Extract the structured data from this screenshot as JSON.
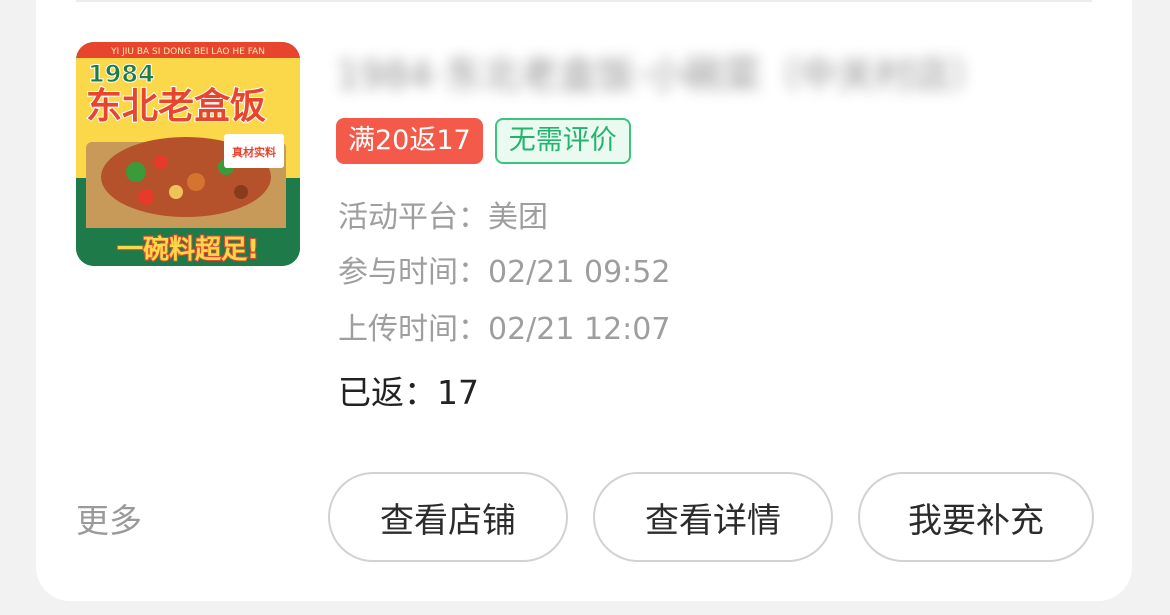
{
  "colors": {
    "page_bg": "#f2f2f2",
    "card_bg": "#ffffff",
    "tag_red": "#f45a4a",
    "tag_green_text": "#22b46c",
    "tag_green_border": "#3cc47d",
    "muted_text": "#9e9e9e"
  },
  "item": {
    "thumbnail": {
      "banner_text": "YI JIU BA SI DONG BEI LAO HE FAN",
      "year_text": "1984",
      "main_text": "东北老盒饭",
      "badge_text": "真材实料",
      "bottom_text": "一碗料超足!"
    },
    "title": "1984·东北老盒饭·小碗菜（中关村店）",
    "tags": {
      "promo": "满20返17",
      "no_review": "无需评价"
    },
    "platform": "活动平台：美团",
    "join_time": "参与时间：02/21 09:52",
    "upload_time": "上传时间：02/21 12:07",
    "returned": "已返：17"
  },
  "actions": {
    "more": "更多",
    "view_store": "查看店铺",
    "view_details": "查看详情",
    "supplement": "我要补充"
  }
}
